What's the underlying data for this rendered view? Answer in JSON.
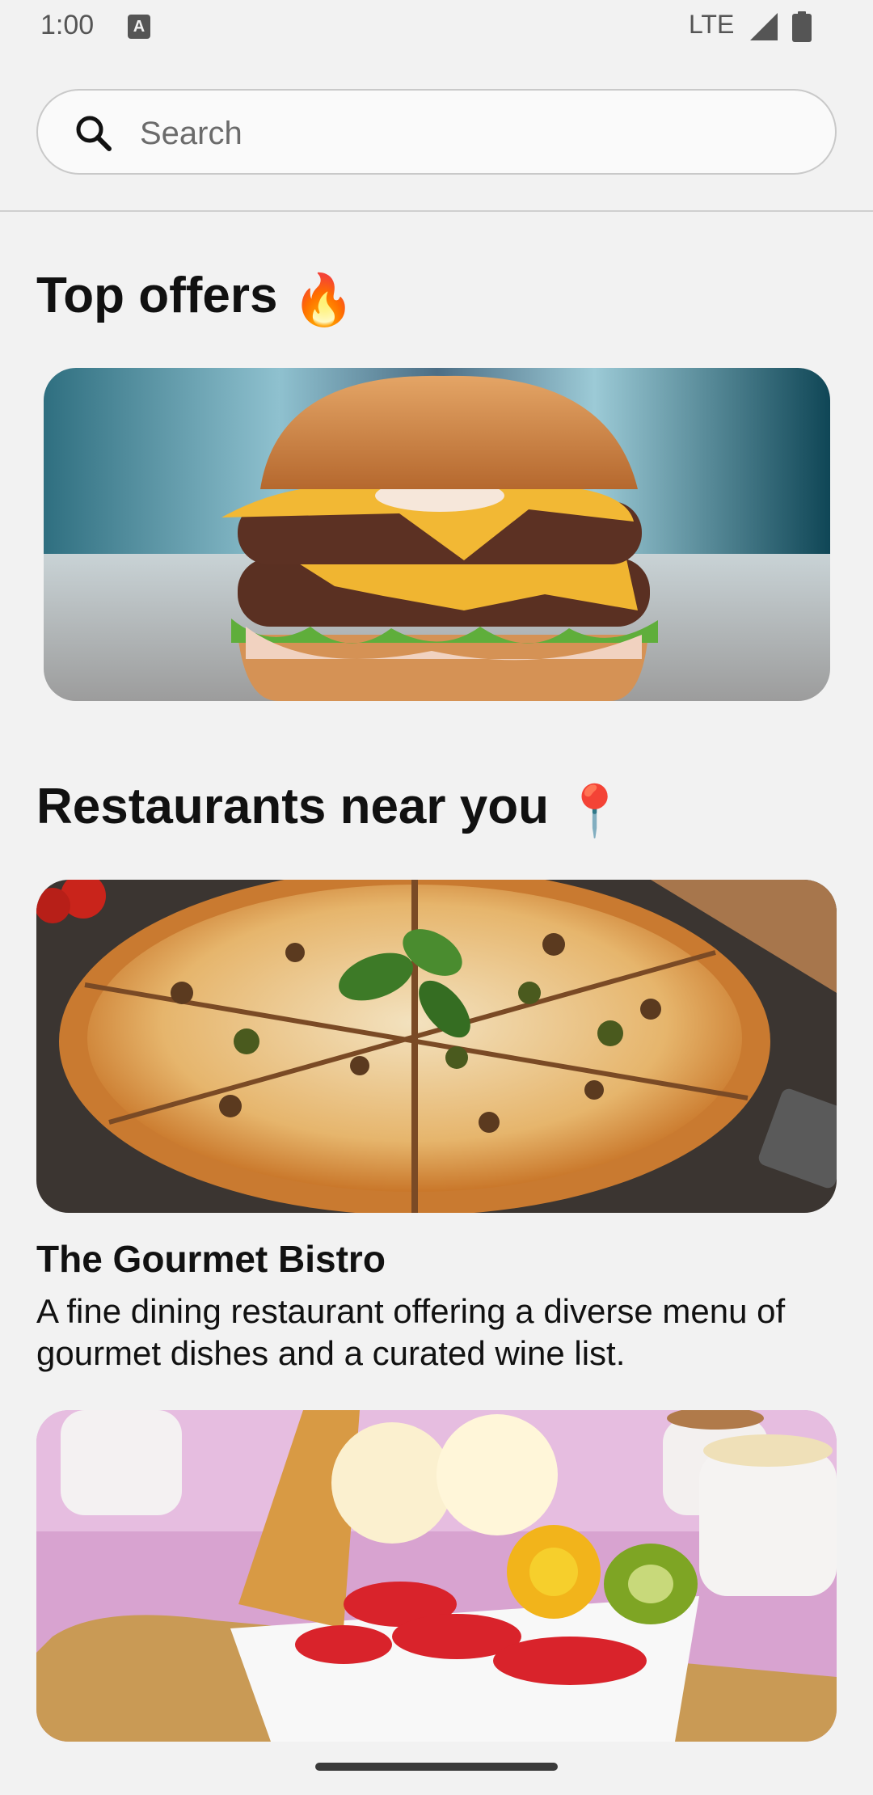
{
  "status_bar": {
    "time": "1:00",
    "network": "LTE",
    "icons": [
      "keyboard-a-icon",
      "signal-icon",
      "battery-icon"
    ]
  },
  "search": {
    "placeholder": "Search",
    "value": "",
    "icon": "search-icon"
  },
  "sections": {
    "top_offers": {
      "title": "Top offers",
      "emoji": "🔥"
    },
    "restaurants": {
      "title": "Restaurants near you",
      "emoji": "📍"
    }
  },
  "restaurants": [
    {
      "name": "The Gourmet Bistro",
      "description": "A fine dining restaurant offering a diverse menu of gourmet dishes and a curated wine list.",
      "image": "pizza-photo"
    },
    {
      "image": "ice-cream-fruit-bowl-photo"
    }
  ],
  "colors": {
    "background": "#f2f2f2",
    "text": "#111111",
    "muted": "#6b6b6b",
    "divider": "#cfcfcf"
  }
}
